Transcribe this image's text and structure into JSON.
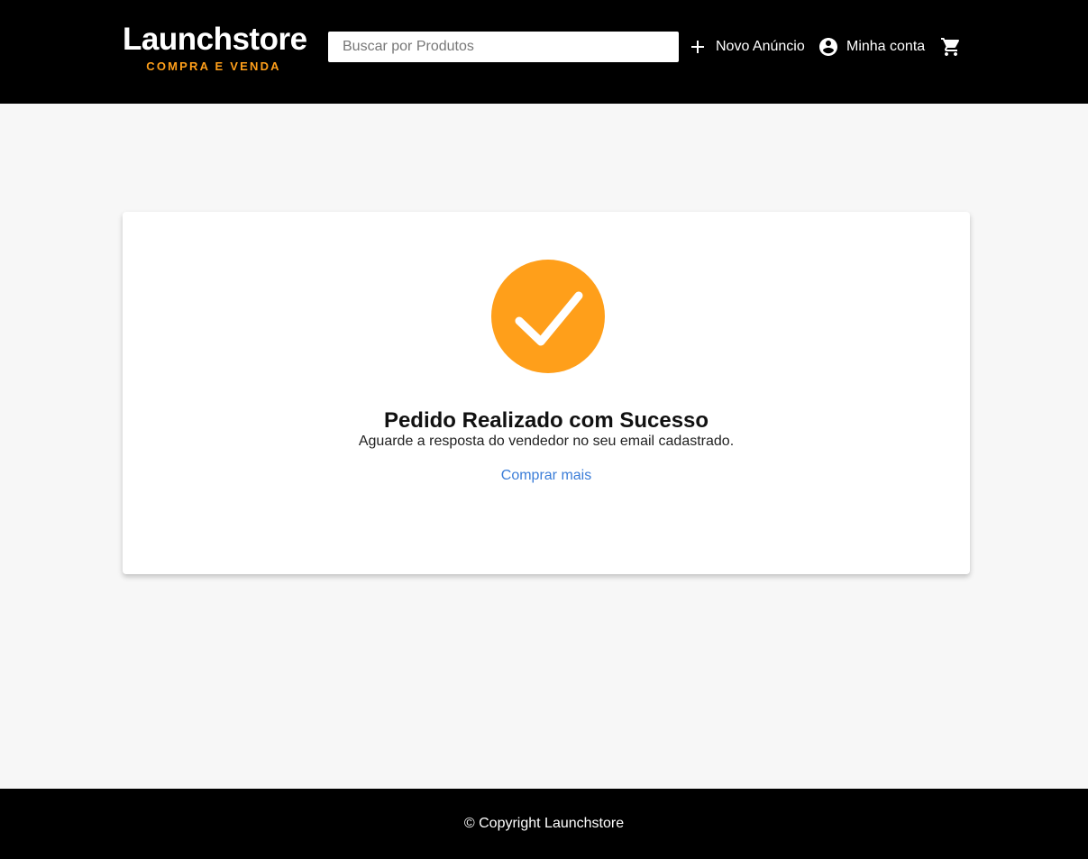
{
  "header": {
    "logo_title": "Launchstore",
    "logo_subtitle": "COMPRA E VENDA",
    "search_placeholder": "Buscar por Produtos",
    "nav": {
      "new_ad_label": "Novo Anúncio",
      "new_ad_icon": "plus-icon",
      "account_label": "Minha conta",
      "account_icon": "account-circle-icon",
      "cart_icon": "shopping-cart-icon"
    }
  },
  "main": {
    "success_icon": "check-circle-icon",
    "title": "Pedido Realizado com Sucesso",
    "subtitle": "Aguarde a resposta do vendedor no seu email cadastrado.",
    "link_label": "Comprar mais"
  },
  "footer": {
    "copyright": "© Copyright Launchstore"
  },
  "colors": {
    "header_bg": "#000000",
    "accent": "#ff9f1a",
    "page_bg": "#f7f7f7",
    "link": "#3b7dd8"
  }
}
